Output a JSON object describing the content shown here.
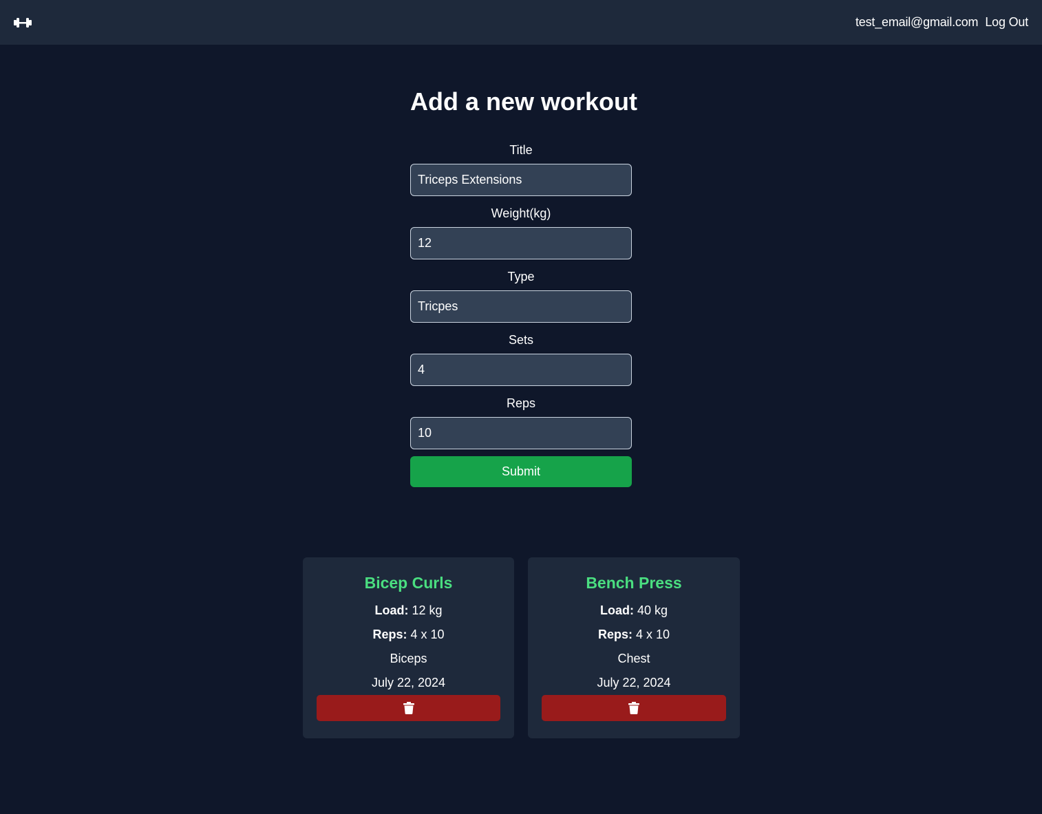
{
  "navbar": {
    "logo_icon": "dumbbell-icon",
    "email": "test_email@gmail.com",
    "logout_label": "Log Out"
  },
  "form": {
    "heading": "Add a new workout",
    "title_label": "Title",
    "title_value": "Triceps Extensions",
    "weight_label": "Weight(kg)",
    "weight_value": "12",
    "type_label": "Type",
    "type_value": "Tricpes",
    "sets_label": "Sets",
    "sets_value": "4",
    "reps_label": "Reps",
    "reps_value": "10",
    "submit_label": "Submit"
  },
  "workouts": [
    {
      "title": "Bicep Curls",
      "load_label": "Load:",
      "load_value": "12 kg",
      "reps_label": "Reps:",
      "reps_value": "4 x 10",
      "type": "Biceps",
      "date": "July 22, 2024",
      "delete_icon": "trash-icon"
    },
    {
      "title": "Bench Press",
      "load_label": "Load:",
      "load_value": "40 kg",
      "reps_label": "Reps:",
      "reps_value": "4 x 10",
      "type": "Chest",
      "date": "July 22, 2024",
      "delete_icon": "trash-icon"
    }
  ],
  "colors": {
    "background": "#0f172a",
    "navbar": "#1e293b",
    "input_bg": "#334155",
    "submit": "#16a34a",
    "card_title": "#4ade80",
    "delete": "#991b1b"
  }
}
